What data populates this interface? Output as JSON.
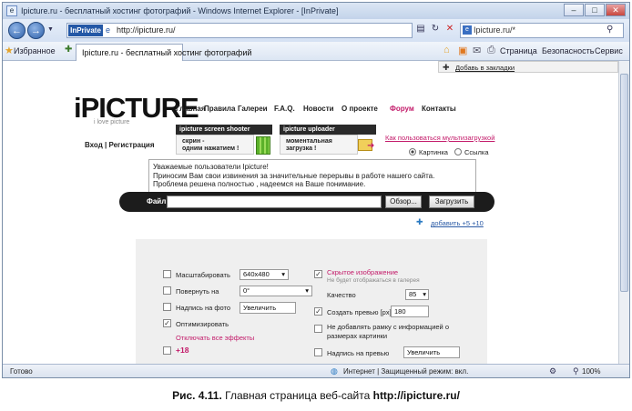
{
  "window": {
    "title": "Ipicture.ru - бесплатный хостинг фотографий - Windows Internet Explorer - [InPrivate]",
    "minimize": "–",
    "maximize": "□",
    "close": "✕"
  },
  "address_bar": {
    "inprivate": "InPrivate",
    "url": "http://ipicture.ru/",
    "search_text": "Ipicture.ru/*",
    "search_icon": "magnifier-icon"
  },
  "favorites_bar": {
    "favorites_label": "Избранное",
    "tab_title": "Ipicture.ru - бесплатный хостинг фотографий"
  },
  "command_bar": {
    "page_label": "Страница",
    "security_label": "Безопасность",
    "service_label": "Сервис"
  },
  "site": {
    "bookmark_link": "Добавь в закладки",
    "logo": "iPICTURE",
    "tagline": "i love picture",
    "menu": [
      "Главная",
      "Правила",
      "Галереи",
      "F.A.Q.",
      "Новости",
      "О проекте",
      "Форум",
      "Контакты"
    ],
    "forum_color": "#c31b6a",
    "login_link": "Вход | Регистрация",
    "promo_screen_shooter": {
      "title": "ipicture screen shooter",
      "line1": "скрин -",
      "line2": "одним нажатием !"
    },
    "promo_uploader": {
      "title": "ipicture uploader",
      "line1": "моментальная",
      "line2": "загрузка !"
    },
    "multi_upload_link": "Как пользоваться мультизагрузкой",
    "upload_type": {
      "option_picture": "Картинка",
      "option_link": "Ссылка",
      "selected": "Картинка"
    },
    "notice": "Уважаемые пользователи Ipicture!\nПриносим Вам свои извинения за значительные перерывы в работе нашего сайта.\nПроблема решена полностью , надеемся на Ваше понимание.",
    "upload": {
      "file_label": "Файл:",
      "browse_button": "Обзор...",
      "upload_button": "Загрузить"
    },
    "add_more": "добавить +5 +10",
    "options_left": [
      {
        "label": "Масштабировать",
        "checked": false,
        "control": "select",
        "value": "640x480"
      },
      {
        "label": "Повернуть на",
        "checked": false,
        "control": "select",
        "value": "0°"
      },
      {
        "label": "Надпись на фото",
        "checked": false,
        "control": "input",
        "value": "Увеличить"
      },
      {
        "label": "Оптимизировать",
        "checked": true
      },
      {
        "label": "Отключать все эффекты",
        "link": true
      },
      {
        "label": "+18",
        "checked": false,
        "pink": true
      }
    ],
    "options_right": {
      "hidden_title": "Скрытое изображение",
      "hidden_subtitle": "Не будет отображаться в галерея",
      "hidden_checked": true,
      "quality_label": "Качество",
      "quality_value": "85",
      "preview_label": "Создать превью [px]",
      "preview_checked": true,
      "preview_value": "180",
      "no_frame_line1": "Не добавлять рамку с информацией о",
      "no_frame_line2": "размерах картинки",
      "no_frame_checked": false,
      "preview_caption_label": "Надпись на превью",
      "preview_caption_value": "Увеличить",
      "preview_caption_checked": false
    }
  },
  "status_bar": {
    "status": "Готово",
    "zone": "Интернет | Защищенный режим: вкл.",
    "zoom": "100%"
  },
  "caption": {
    "prefix": "Рис. 4.11.",
    "text": " Главная страница веб-сайта ",
    "url": "http://ipicture.ru/"
  }
}
